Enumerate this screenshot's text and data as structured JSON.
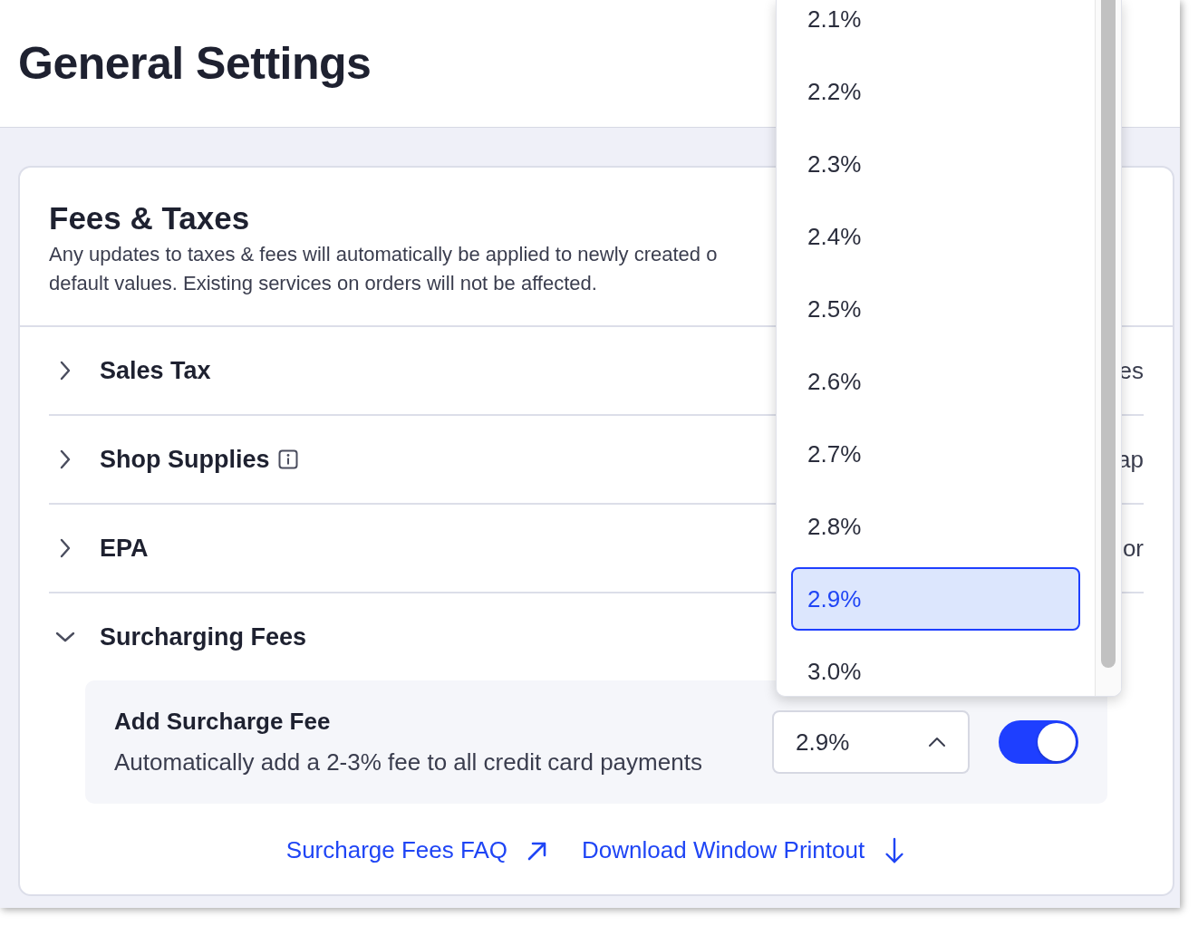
{
  "page": {
    "title": "General Settings"
  },
  "card": {
    "title": "Fees & Taxes",
    "description_lines": [
      "Any updates to taxes & fees will automatically be applied to newly created o",
      "default values. Existing services on orders will not be affected."
    ],
    "sections": [
      {
        "label": "Sales Tax",
        "info": false,
        "expanded": false,
        "fragment": "es"
      },
      {
        "label": "Shop Supplies",
        "info": true,
        "expanded": false,
        "fragment": "ap"
      },
      {
        "label": "EPA",
        "info": false,
        "expanded": false,
        "fragment": "or"
      },
      {
        "label": "Surcharging Fees",
        "info": false,
        "expanded": true
      }
    ],
    "surcharge": {
      "title": "Add Surcharge Fee",
      "description": "Automatically add a 2-3% fee to all credit card payments",
      "value": "2.9%",
      "open": true,
      "on": true
    },
    "links": [
      {
        "label": "Surcharge Fees FAQ",
        "kind": "external"
      },
      {
        "label": "Download Window Printout",
        "kind": "download"
      }
    ]
  },
  "dropdown": {
    "options": [
      {
        "label": "2.1%",
        "selected": false
      },
      {
        "label": "2.2%",
        "selected": false
      },
      {
        "label": "2.3%",
        "selected": false
      },
      {
        "label": "2.4%",
        "selected": false
      },
      {
        "label": "2.5%",
        "selected": false
      },
      {
        "label": "2.6%",
        "selected": false
      },
      {
        "label": "2.7%",
        "selected": false
      },
      {
        "label": "2.8%",
        "selected": false
      },
      {
        "label": "2.9%",
        "selected": true
      },
      {
        "label": "3.0%",
        "selected": false
      }
    ]
  }
}
